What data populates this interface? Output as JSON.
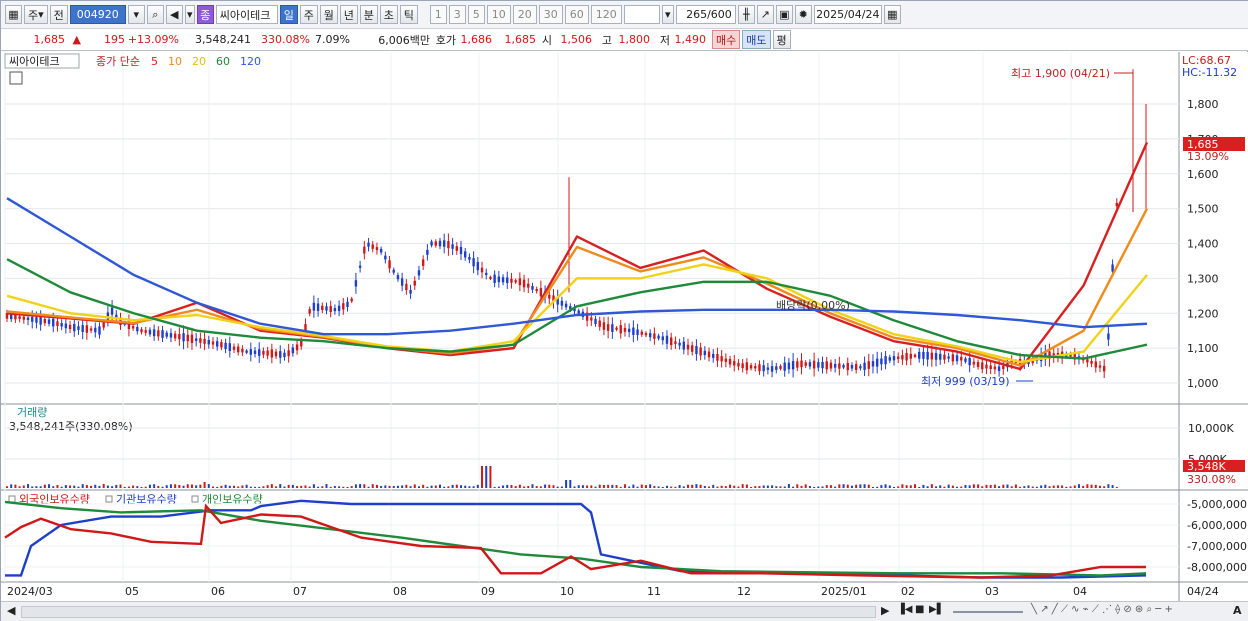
{
  "toolbar": {
    "period_type": "주",
    "prev_label": "전",
    "code": "004920",
    "stock_name": "씨아이테크",
    "stock_badge": "종",
    "intervals": [
      "일",
      "주",
      "월",
      "년",
      "분",
      "초",
      "틱"
    ],
    "active_interval": "일",
    "minute_units": [
      "1",
      "3",
      "5",
      "10",
      "20",
      "30",
      "60",
      "120"
    ],
    "view_count": "265",
    "view_total": "/600",
    "date": "2025/04/24"
  },
  "quote": {
    "price": "1,685",
    "change": "195",
    "change_pct": "+13.09%",
    "volume": "3,548,241",
    "volume_ratio": "330.08%",
    "turnover": "7.09%",
    "amount": "6,006백만",
    "bid_label": "호가",
    "ask": "1,686",
    "bid": "1,685",
    "open_label": "시",
    "open": "1,506",
    "high_label": "고",
    "high": "1,800",
    "low_label": "저",
    "low": "1,490",
    "buy_label": "매수",
    "sell_label": "매도",
    "eval_label": "평"
  },
  "price_panel": {
    "name_tag": "씨아이테크",
    "ma_title": "종가 단순",
    "ma_periods": [
      "5",
      "10",
      "20",
      "60",
      "120"
    ],
    "lc": "LC:68.67",
    "hc": "HC:-11.32",
    "high_note": "최고 1,900 (04/21)",
    "low_note": "최저 999 (03/19)",
    "dividend_note": "배당락(0.00%)",
    "current_price": "1,685",
    "current_pct": "13.09%",
    "ticks": [
      "1,800",
      "1,700",
      "1,600",
      "1,500",
      "1,400",
      "1,300",
      "1,200",
      "1,100",
      "1,000"
    ]
  },
  "volume_panel": {
    "title": "거래량",
    "value": "3,548,241주(330.08%)",
    "ticks": [
      "10,000K",
      "5,000K"
    ],
    "current": "3,548K",
    "current_pct": "330.08%"
  },
  "holdings_panel": {
    "legend": [
      "외국인보유수량",
      "기관보유수량",
      "개인보유수량"
    ],
    "ticks": [
      "-5,000,000",
      "-6,000,000",
      "-7,000,000",
      "-8,000,000"
    ]
  },
  "x_axis": {
    "labels": [
      "2024/03",
      "05",
      "06",
      "07",
      "08",
      "09",
      "10",
      "11",
      "12",
      "2025/01",
      "02",
      "03",
      "04"
    ],
    "end_label": "04/24"
  },
  "colors": {
    "up": "#d01818",
    "down": "#1e3fc8",
    "ma5": "#d82020",
    "ma10": "#f08a1c",
    "ma20": "#f0d21a",
    "ma60": "#1e8a3a",
    "ma120": "#2f58d6"
  },
  "chart_data": {
    "type": "candlestick",
    "title": "씨아이테크",
    "ylim": [
      960,
      1930
    ],
    "x": [
      "2024/03",
      "05",
      "06",
      "07",
      "08",
      "09",
      "10",
      "11",
      "12",
      "2025/01",
      "02",
      "03",
      "04"
    ],
    "series": [
      {
        "name": "5",
        "values": [
          1200,
          1185,
          1170,
          1230,
          1150,
          1130,
          1100,
          1080,
          1100,
          1420,
          1330,
          1380,
          1270,
          1190,
          1120,
          1090,
          1040,
          1280,
          1690
        ]
      },
      {
        "name": "10",
        "values": [
          1205,
          1188,
          1172,
          1210,
          1155,
          1132,
          1102,
          1085,
          1110,
          1390,
          1320,
          1360,
          1285,
          1200,
          1130,
          1100,
          1050,
          1150,
          1500
        ]
      },
      {
        "name": "20",
        "values": [
          1250,
          1200,
          1180,
          1195,
          1160,
          1135,
          1105,
          1090,
          1120,
          1300,
          1300,
          1340,
          1300,
          1210,
          1140,
          1105,
          1060,
          1090,
          1310
        ]
      },
      {
        "name": "60",
        "values": [
          1355,
          1260,
          1200,
          1150,
          1130,
          1120,
          1100,
          1090,
          1110,
          1220,
          1260,
          1290,
          1290,
          1250,
          1180,
          1120,
          1080,
          1070,
          1110
        ]
      },
      {
        "name": "120",
        "values": [
          1530,
          1420,
          1310,
          1230,
          1170,
          1140,
          1140,
          1150,
          1170,
          1195,
          1205,
          1210,
          1210,
          1210,
          1205,
          1195,
          1180,
          1160,
          1170
        ]
      }
    ],
    "volume_last_k": 3548,
    "holdings": [
      {
        "name": "외국인보유수량"
      },
      {
        "name": "기관보유수량"
      },
      {
        "name": "개인보유수량"
      }
    ]
  }
}
